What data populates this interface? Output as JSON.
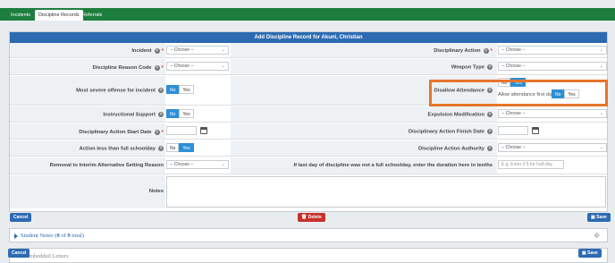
{
  "nav": {
    "tabs": [
      "Incidents",
      "Discipline Records",
      "Referrals"
    ]
  },
  "panel": {
    "title": "Add Discipline Record for Akuni, Christian"
  },
  "fields": {
    "incident": {
      "label": "Incident",
      "value": "-- Choose --"
    },
    "disciplinary_action": {
      "label": "Disciplinary Action",
      "value": "-- Choose --"
    },
    "reason_code": {
      "label": "Discipline Reason Code",
      "value": "-- Choose --"
    },
    "weapon_type": {
      "label": "Weapon Type",
      "value": "-- Choose --"
    },
    "most_severe": {
      "label": "Most severe offense for incident",
      "no": "No",
      "yes": "Yes"
    },
    "disallow_attendance": {
      "label": "Disallow Attendance",
      "no": "No",
      "yes": "Yes",
      "first_day_label": "Allow attendance first day?",
      "first_no": "No",
      "first_yes": "Yes"
    },
    "instructional_support": {
      "label": "Instructional Support",
      "no": "No",
      "yes": "Yes"
    },
    "expulsion_modification": {
      "label": "Expulsion Modification",
      "value": "-- Choose --"
    },
    "start_date": {
      "label": "Disciplinary Action Start Date"
    },
    "finish_date": {
      "label": "Disciplinary Action Finish Date"
    },
    "less_than_full": {
      "label": "Action less than full schoolday",
      "no": "No",
      "yes": "Yes"
    },
    "authority": {
      "label": "Discipline Action Authority",
      "value": "-- Choose --"
    },
    "removal": {
      "label": "Removal to Interim Alternative Setting Reason",
      "value": "-- Choose --"
    },
    "duration": {
      "label": "If last day of discipline was not a full schoolday, enter the duration here in tenths",
      "placeholder": "E.g. Enter 0.5 for half-day"
    },
    "notes": {
      "label": "Notes"
    }
  },
  "buttons": {
    "cancel": "Cancel",
    "delete": "Delete",
    "save": "Save"
  },
  "student_notes": {
    "prefix": "Student Notes (",
    "count": "0",
    "of": " of ",
    "total": "9",
    "suffix": " total)"
  },
  "letters": {
    "text": "Embedded Letters"
  },
  "colors": {
    "accent_green": "#1e7e3e",
    "header_blue": "#2c6bb2",
    "toggle_blue": "#2c8fd6",
    "highlight_orange": "#e8742a",
    "delete_red": "#c9302c"
  }
}
